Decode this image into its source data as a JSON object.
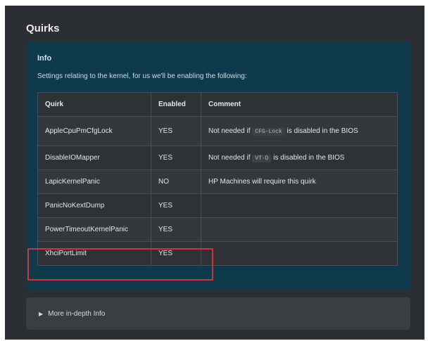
{
  "section": {
    "title": "Quirks"
  },
  "info": {
    "title": "Info",
    "description": "Settings relating to the kernel, for us we'll be enabling the following:"
  },
  "table": {
    "headers": [
      "Quirk",
      "Enabled",
      "Comment"
    ],
    "rows": [
      {
        "quirk": "AppleCpuPmCfgLock",
        "enabled": "YES",
        "comment_pre": "Not needed if",
        "comment_code": "CFG-Lock",
        "comment_post": "is disabled in the BIOS"
      },
      {
        "quirk": "DisableIOMapper",
        "enabled": "YES",
        "comment_pre": "Not needed if",
        "comment_code": "VT-D",
        "comment_post": "is disabled in the BIOS"
      },
      {
        "quirk": "LapicKernelPanic",
        "enabled": "NO",
        "comment": "HP Machines will require this quirk"
      },
      {
        "quirk": "PanicNoKextDump",
        "enabled": "YES",
        "comment": ""
      },
      {
        "quirk": "PowerTimeoutKernelPanic",
        "enabled": "YES",
        "comment": ""
      },
      {
        "quirk": "XhciPortLimit",
        "enabled": "YES",
        "comment": ""
      }
    ]
  },
  "details": {
    "label": "More in-depth Info"
  },
  "colors": {
    "page_bg": "#2b2e33",
    "info_bg": "#0e3a4c",
    "highlight": "#d0343b"
  },
  "icons": {
    "details_toggle": "triangle-right-icon"
  }
}
